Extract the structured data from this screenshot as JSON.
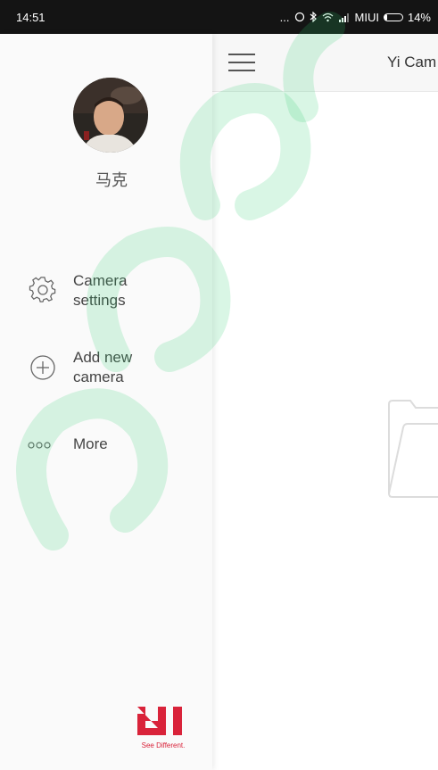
{
  "status_bar": {
    "time": "14:51",
    "dots": "...",
    "carrier": "MIUI",
    "battery_percent": "14%",
    "battery_level": 0.14
  },
  "app_bar": {
    "title": "Yi Cam"
  },
  "drawer": {
    "user_name": "马克",
    "menu": [
      {
        "icon": "gear-icon",
        "label_line1": "Camera",
        "label_line2": "settings"
      },
      {
        "icon": "plus-circle-icon",
        "label_line1": "Add new",
        "label_line2": "camera"
      },
      {
        "icon": "more-dots-icon",
        "label_line1": "More",
        "label_line2": ""
      }
    ],
    "brand": {
      "logo": "YI",
      "tagline": "See Different."
    }
  },
  "colors": {
    "brand_red": "#d9233a",
    "watermark_green": "#2ecc71",
    "status_bar": "#141414"
  }
}
